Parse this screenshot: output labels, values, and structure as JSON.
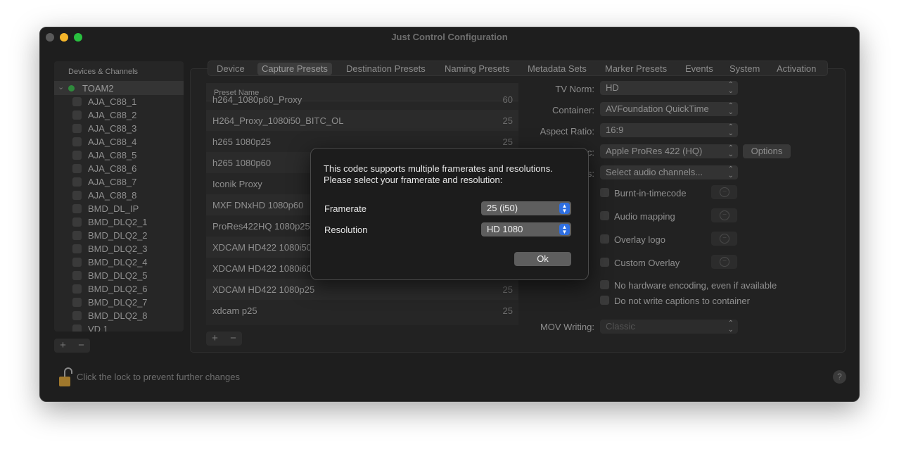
{
  "window": {
    "title": "Just Control Configuration"
  },
  "sidebar": {
    "header": "Devices & Channels",
    "group": "TOAM2",
    "channels": [
      "AJA_C88_1",
      "AJA_C88_2",
      "AJA_C88_3",
      "AJA_C88_4",
      "AJA_C88_5",
      "AJA_C88_6",
      "AJA_C88_7",
      "AJA_C88_8",
      "BMD_DL_IP",
      "BMD_DLQ2_1",
      "BMD_DLQ2_2",
      "BMD_DLQ2_3",
      "BMD_DLQ2_4",
      "BMD_DLQ2_5",
      "BMD_DLQ2_6",
      "BMD_DLQ2_7",
      "BMD_DLQ2_8",
      "VD 1"
    ],
    "add": "+",
    "remove": "−"
  },
  "tabs": [
    "Device",
    "Capture Presets",
    "Destination Presets",
    "Naming Presets",
    "Metadata Sets",
    "Marker Presets",
    "Events",
    "System",
    "Activation"
  ],
  "active_tab": "Capture Presets",
  "preset_table": {
    "header": "Preset Name",
    "rows": [
      {
        "name": "h264_1080p60_Proxy",
        "fr": "60"
      },
      {
        "name": "H264_Proxy_1080i50_BITC_OL",
        "fr": "25"
      },
      {
        "name": "h265 1080p25",
        "fr": "25"
      },
      {
        "name": "h265 1080p60",
        "fr": ""
      },
      {
        "name": "Iconik Proxy",
        "fr": ""
      },
      {
        "name": "MXF DNxHD 1080p60",
        "fr": ""
      },
      {
        "name": "ProRes422HQ 1080p25",
        "fr": ""
      },
      {
        "name": "XDCAM HD422 1080i50",
        "fr": ""
      },
      {
        "name": "XDCAM HD422 1080i60",
        "fr": ""
      },
      {
        "name": "XDCAM HD422 1080p25",
        "fr": "25"
      },
      {
        "name": "xdcam p25",
        "fr": "25"
      }
    ],
    "add": "+",
    "remove": "−"
  },
  "form": {
    "tv_norm_label": "TV Norm:",
    "tv_norm": "HD",
    "container_label": "Container:",
    "container": "AVFoundation QuickTime",
    "aspect_label": "Aspect Ratio:",
    "aspect": "16:9",
    "codec_label": "c:",
    "codec": "Apple ProRes 422 (HQ)",
    "options": "Options",
    "audio_label": "s:",
    "audio": "Select audio channels...",
    "burnt_in": "Burnt-in-timecode",
    "audio_mapping": "Audio mapping",
    "overlay_logo": "Overlay logo",
    "custom_overlay": "Custom Overlay",
    "no_hw": "No hardware encoding, even if available",
    "no_captions": "Do not write captions to container",
    "mov_label": "MOV Writing:",
    "mov": "Classic"
  },
  "footer": {
    "lock_text": "Click the lock to prevent further changes",
    "help": "?"
  },
  "dialog": {
    "line1": "This codec supports multiple framerates and resolutions.",
    "line2": "Please select your framerate and resolution:",
    "framerate_label": "Framerate",
    "framerate": "25 (i50)",
    "resolution_label": "Resolution",
    "resolution": "HD 1080",
    "ok": "Ok"
  }
}
